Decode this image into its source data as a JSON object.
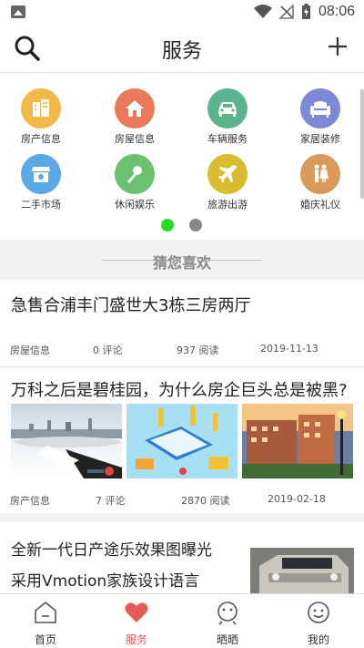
{
  "status_bar": {
    "time": "08:06"
  },
  "header": {
    "title": "服务"
  },
  "services": [
    {
      "label": "房产信息",
      "color": "#f0b94a",
      "icon": "building-icon"
    },
    {
      "label": "房屋信息",
      "color": "#e9795a",
      "icon": "home-icon"
    },
    {
      "label": "车辆服务",
      "color": "#5cb48f",
      "icon": "car-icon"
    },
    {
      "label": "家居装修",
      "color": "#7d88d6",
      "icon": "sofa-icon"
    },
    {
      "label": "二手市场",
      "color": "#5aa8e6",
      "icon": "shop-icon"
    },
    {
      "label": "休闲娱乐",
      "color": "#6cc070",
      "icon": "microphone-icon"
    },
    {
      "label": "旅游出游",
      "color": "#d9bd2f",
      "icon": "airplane-icon"
    },
    {
      "label": "婚庆礼仪",
      "color": "#d99a5a",
      "icon": "couple-icon"
    }
  ],
  "pager": {
    "active_color": "#22dd22",
    "inactive_color": "#888888"
  },
  "section": {
    "title": "猜您喜欢"
  },
  "articles": [
    {
      "title": "急售合浦丰门盛世大3栋三房两厅",
      "category": "房屋信息",
      "comments": "0 评论",
      "reads": "937 阅读",
      "date": "2019-11-13"
    },
    {
      "title": "万科之后是碧桂园，为什么房企巨头总是被黑?",
      "category": "房产信息",
      "comments": "7 评论",
      "reads": "2870 阅读",
      "date": "2019-02-18"
    },
    {
      "title_line1": "全新一代日产途乐效果图曝光",
      "title_line2": "采用Vmotion家族设计语言"
    }
  ],
  "tabs": [
    {
      "label": "首页",
      "icon": "home-tab-icon"
    },
    {
      "label": "服务",
      "icon": "heart-tab-icon",
      "active": true
    },
    {
      "label": "晒晒",
      "icon": "share-face-icon"
    },
    {
      "label": "我的",
      "icon": "smile-face-icon"
    }
  ],
  "accent": "#e85a5a"
}
